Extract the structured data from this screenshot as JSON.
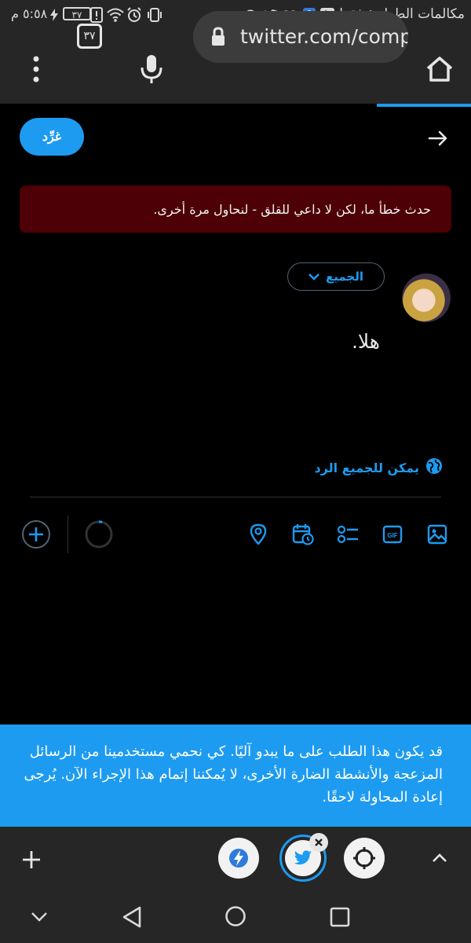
{
  "status_bar": {
    "time": "٥:٥٨ م",
    "battery": "٣٧",
    "carrier": "مكالمات الطوارئ فقط"
  },
  "browser": {
    "url": "twitter.com/comp",
    "tab_count": "٣٧"
  },
  "compose": {
    "reply_button": "غرِّد",
    "error_message": "حدث خطأ ما، لكن لا داعي للقلق - لنحاول مرة أخرى.",
    "audience": "الجميع",
    "tweet_text": "هلا.",
    "reply_setting": "يمكن للجميع الرد"
  },
  "notice": {
    "text": "قد يكون هذا الطلب على ما يبدو آليًا. كي نحمي مستخدمينا من الرسائل المزعجة والأنشطة الضارة الأخرى، لا يُمكننا إتمام هذا الإجراء الآن. يُرجى إعادة المحاولة لاحقًا."
  },
  "icons": {
    "home": "home-icon",
    "lock": "lock-icon",
    "mic": "microphone-icon",
    "menu": "more-vert-icon",
    "back": "arrow-right-icon",
    "globe": "globe-icon",
    "media": "image-icon",
    "gif": "gif-icon",
    "poll": "poll-icon",
    "schedule": "schedule-icon",
    "location": "location-icon",
    "add": "add-circle-icon"
  },
  "colors": {
    "accent": "#1d9bf0",
    "error_bg": "#4d0005",
    "bar_bg": "#262626"
  }
}
